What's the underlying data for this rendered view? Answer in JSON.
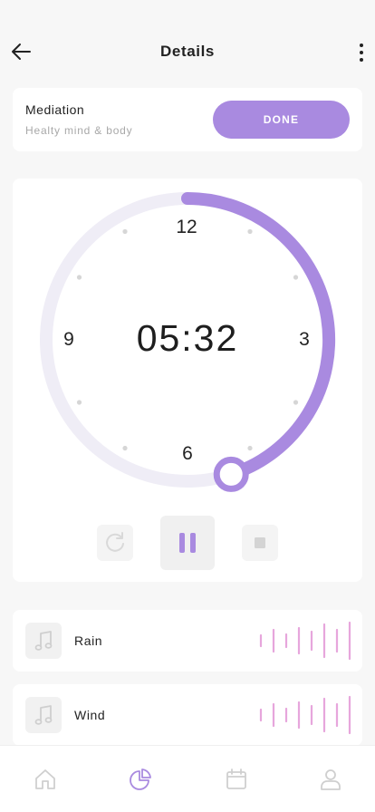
{
  "header": {
    "title": "Details",
    "back_icon": "arrow-left-icon",
    "more_icon": "more-vertical-icon"
  },
  "session": {
    "name": "Mediation",
    "subtitle": "Healty mind & body",
    "done_label": "DONE"
  },
  "timer": {
    "time": "05:32",
    "progress": 0.45,
    "hour_labels": {
      "twelve": "12",
      "three": "3",
      "six": "6",
      "nine": "9"
    },
    "controls": [
      "restart-icon",
      "pause-icon",
      "stop-icon"
    ]
  },
  "sounds": [
    {
      "label": "Rain",
      "icon": "music-note-icon"
    },
    {
      "label": "Wind",
      "icon": "music-note-icon"
    }
  ],
  "tabs": [
    {
      "name": "home",
      "icon": "home-icon",
      "active": false
    },
    {
      "name": "stats",
      "icon": "pie-chart-icon",
      "active": true
    },
    {
      "name": "calendar",
      "icon": "calendar-icon",
      "active": false
    },
    {
      "name": "profile",
      "icon": "user-icon",
      "active": false
    }
  ],
  "colors": {
    "accent": "#a98ae0",
    "track": "#efedf6",
    "wave": "#e7a6dc",
    "inactive_icon": "#cfcfcf"
  }
}
